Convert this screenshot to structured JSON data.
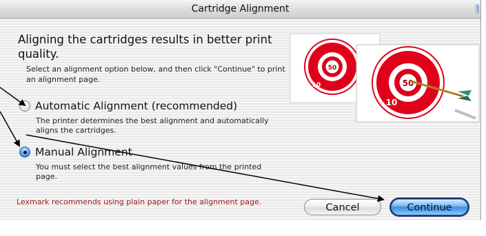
{
  "window": {
    "title": "Cartridge Alignment"
  },
  "heading": "Aligning the cartridges results in better print quality.",
  "description": "Select an alignment option below, and then click \"Continue\" to print an alignment page.",
  "options": [
    {
      "label": "Automatic Alignment (recommended)",
      "description": "The printer determines the best alignment and automatically aligns the cartridges.",
      "selected": false
    },
    {
      "label": "Manual Alignment",
      "description": "You must select the best alignment values from the printed page.",
      "selected": true
    }
  ],
  "note": "Lexmark recommends using plain paper for the alignment page.",
  "buttons": {
    "cancel": "Cancel",
    "continue": "Continue"
  },
  "illustration": {
    "back_target": {
      "inner": "50",
      "outer": "10"
    },
    "front_target": {
      "inner": "50",
      "outer": "10"
    }
  },
  "colors": {
    "target_red": "#e0001a",
    "note_red": "#a01818",
    "accent_blue": "#3c8ee0"
  }
}
